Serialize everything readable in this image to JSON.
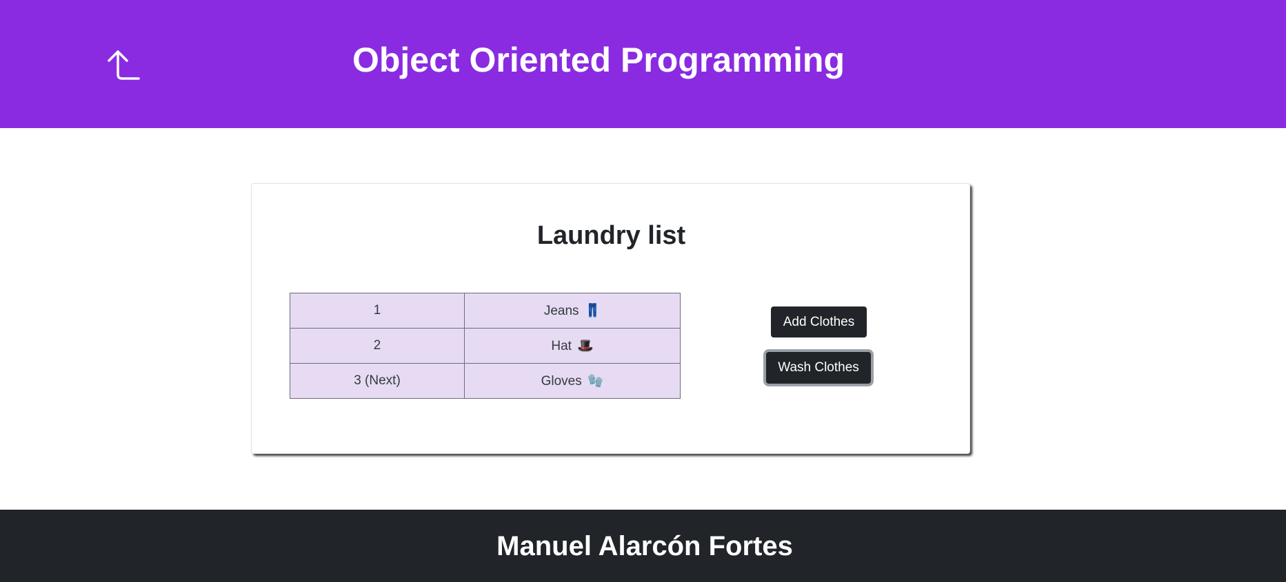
{
  "colors": {
    "header_bg": "#8a2be2",
    "table_bg": "#e6dbf3",
    "button_bg": "#212529",
    "footer_bg": "#212529"
  },
  "header": {
    "back_icon": "arrow-up-left-icon",
    "title": "Object Oriented Programming"
  },
  "card": {
    "title": "Laundry list",
    "rows": [
      {
        "number": "1",
        "item": "Jeans",
        "emoji": "👖",
        "icon": "jeans-icon"
      },
      {
        "number": "2",
        "item": "Hat",
        "emoji": "🎩",
        "icon": "top-hat-icon"
      },
      {
        "number": "3 (Next)",
        "item": "Gloves",
        "emoji": "🧤",
        "icon": "gloves-icon"
      }
    ],
    "add_label": "Add Clothes",
    "wash_label": "Wash Clothes"
  },
  "footer": {
    "author": "Manuel Alarcón Fortes"
  }
}
